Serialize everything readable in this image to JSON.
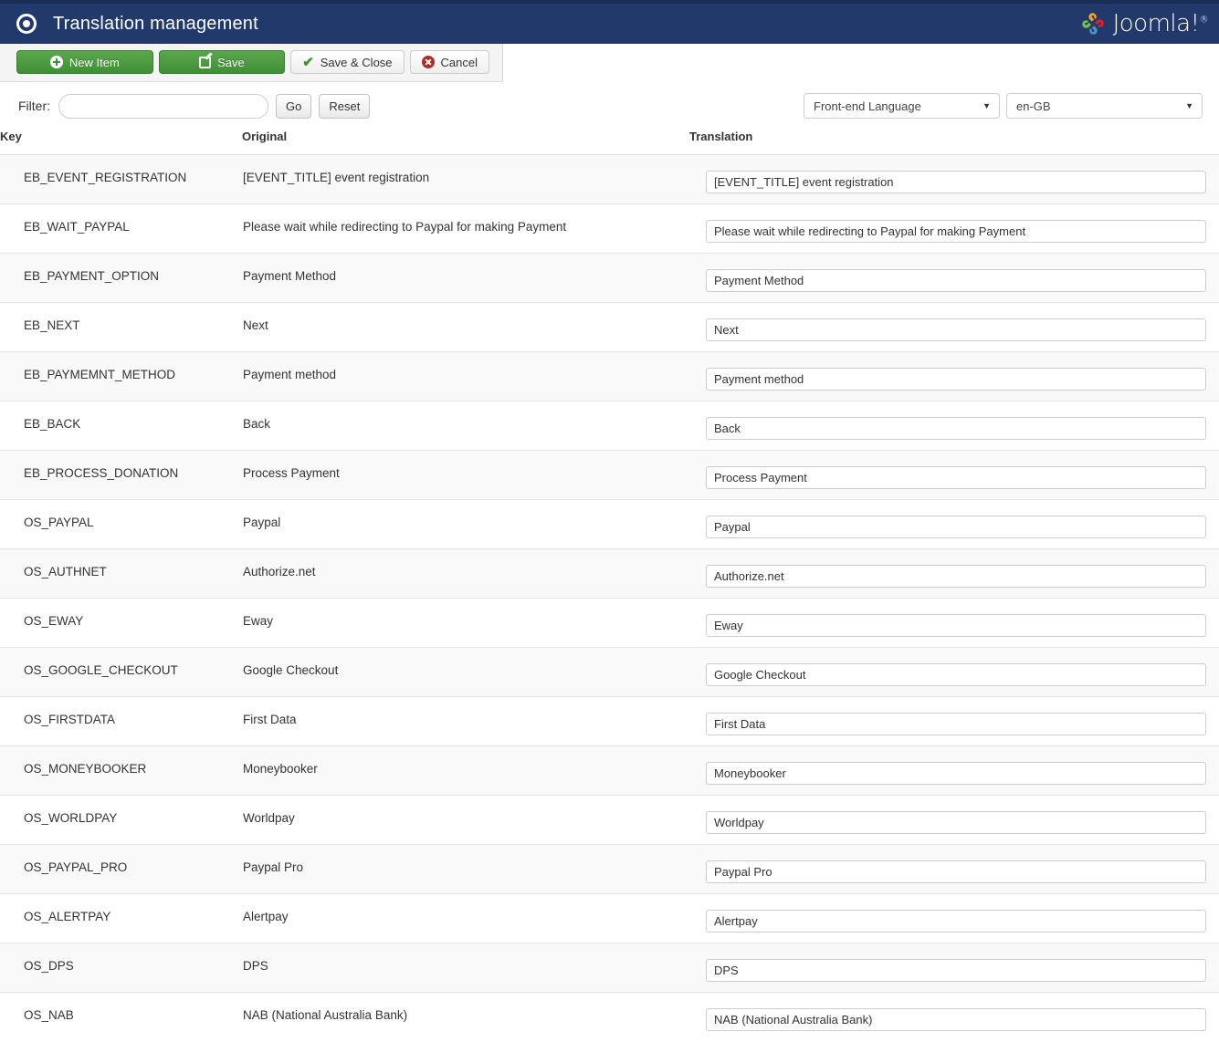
{
  "header": {
    "icon": "bullseye-icon",
    "title": "Translation management",
    "brand": "Joomla!",
    "brand_sup": "®",
    "bar_color": "#22396b"
  },
  "toolbar": {
    "new_item_label": "New Item",
    "save_label": "Save",
    "save_close_label": "Save & Close",
    "cancel_label": "Cancel",
    "green": "#46a03c"
  },
  "filter": {
    "label": "Filter:",
    "value": "",
    "placeholder": "",
    "go_label": "Go",
    "reset_label": "Reset"
  },
  "selects": {
    "language_scope": "Front-end Language",
    "language_code": "en-GB",
    "caret": "▼"
  },
  "table": {
    "columns": [
      "Key",
      "Original",
      "Translation"
    ],
    "rows": [
      {
        "key": "EB_EVENT_REGISTRATION",
        "original": "[EVENT_TITLE] event registration",
        "translation": "[EVENT_TITLE] event registration"
      },
      {
        "key": "EB_WAIT_PAYPAL",
        "original": "Please wait while redirecting to Paypal for making Payment",
        "translation": "Please wait while redirecting to Paypal for making Payment"
      },
      {
        "key": "EB_PAYMENT_OPTION",
        "original": "Payment Method",
        "translation": "Payment Method"
      },
      {
        "key": "EB_NEXT",
        "original": "Next",
        "translation": "Next"
      },
      {
        "key": "EB_PAYMEMNT_METHOD",
        "original": "Payment method",
        "translation": "Payment method"
      },
      {
        "key": "EB_BACK",
        "original": "Back",
        "translation": "Back"
      },
      {
        "key": "EB_PROCESS_DONATION",
        "original": "Process Payment",
        "translation": "Process Payment"
      },
      {
        "key": "OS_PAYPAL",
        "original": "Paypal",
        "translation": "Paypal"
      },
      {
        "key": "OS_AUTHNET",
        "original": "Authorize.net",
        "translation": "Authorize.net"
      },
      {
        "key": "OS_EWAY",
        "original": "Eway",
        "translation": "Eway"
      },
      {
        "key": "OS_GOOGLE_CHECKOUT",
        "original": "Google Checkout",
        "translation": "Google Checkout"
      },
      {
        "key": "OS_FIRSTDATA",
        "original": "First Data",
        "translation": "First Data"
      },
      {
        "key": "OS_MONEYBOOKER",
        "original": "Moneybooker",
        "translation": "Moneybooker"
      },
      {
        "key": "OS_WORLDPAY",
        "original": "Worldpay",
        "translation": "Worldpay"
      },
      {
        "key": "OS_PAYPAL_PRO",
        "original": "Paypal Pro",
        "translation": "Paypal Pro"
      },
      {
        "key": "OS_ALERTPAY",
        "original": "Alertpay",
        "translation": "Alertpay"
      },
      {
        "key": "OS_DPS",
        "original": "DPS",
        "translation": "DPS"
      },
      {
        "key": "OS_NAB",
        "original": "NAB (National Australia Bank)",
        "translation": "NAB (National Australia Bank)"
      }
    ]
  }
}
